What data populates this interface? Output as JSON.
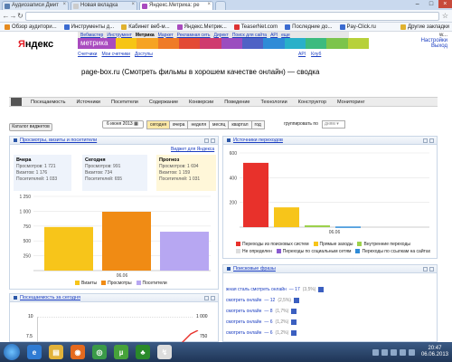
{
  "browser": {
    "tabs": [
      {
        "label": "Аудиозаписи Дмит",
        "favicon_color": "#5a7fb0",
        "active": false
      },
      {
        "label": "Новая вкладка",
        "favicon_color": "#cccccc",
        "active": false
      },
      {
        "label": "Яндекс.Метрика: ре",
        "favicon_color": "#a94bbf",
        "active": true
      }
    ],
    "bookmarks": [
      {
        "label": "Обзор аудитори...",
        "color": "#e58a1f"
      },
      {
        "label": "Инструменты д...",
        "color": "#3b6bd0"
      },
      {
        "label": "Кабинет веб-м...",
        "color": "#e0b22e"
      },
      {
        "label": "Яндекс.Метрик...",
        "color": "#a94bbf"
      },
      {
        "label": "TeaserNet.com",
        "color": "#d33"
      },
      {
        "label": "Последние до...",
        "color": "#3b6bd0"
      },
      {
        "label": "Pay-Click.ru",
        "color": "#3b6bd0"
      },
      {
        "label": "Другие закладки",
        "color": "#e0b22e"
      }
    ]
  },
  "yandex": {
    "logo": "Яндекс",
    "logo_first_letter": "Я",
    "logo_rest": "ндекс",
    "services": [
      "Вебмастер",
      "Инструмент",
      "Метрика",
      "Маркет",
      "Рекламная сеть",
      "Директ",
      "Поиск для сайта",
      "API",
      "еще"
    ],
    "metrika_label": "метрика",
    "sublinks": [
      "Счетчики",
      "Мои счетчики",
      "Доступы"
    ],
    "apilinks": [
      "API",
      "Клуб"
    ],
    "user": "w...",
    "user_links": [
      "Настройки",
      "Выход"
    ],
    "rainbow": [
      "#f6c515",
      "#f6a323",
      "#ef7b27",
      "#e34a35",
      "#cf3b6f",
      "#9b4dbf",
      "#4f62c5",
      "#2f8bd7",
      "#29b0c9",
      "#3cbb7f",
      "#7cc44b",
      "#b7d13a"
    ]
  },
  "page_title": "page-box.ru (Смотреть фильмы в хорошем качестве онлайн) — сводка",
  "nav": [
    "Посещаемость",
    "Источники",
    "Посетители",
    "Содержание",
    "Конверсии",
    "Поведение",
    "Технологии",
    "Конструктор",
    "Мониторинг"
  ],
  "toolbar": {
    "catalog": "Каталог виджетов",
    "date": "6 июня 2013",
    "periods": [
      "сегодня",
      "вчера",
      "неделя",
      "месяц",
      "квартал",
      "год"
    ],
    "selected_period": "сегодня",
    "group_label": "группировать по",
    "group_value": "дням"
  },
  "widget_traffic": {
    "title": "Просмотры, визиты и посетители",
    "link": "Виджет для Яндекса",
    "yesterday": {
      "title": "Вчера",
      "lines": [
        "Просмотров: 1 721",
        "Визитов: 1 176",
        "Посетителей: 1 033"
      ]
    },
    "today": {
      "title": "Сегодня",
      "lines": [
        "Просмотров: 991",
        "Визитов: 734",
        "Посетителей: 655"
      ]
    },
    "forecast": {
      "title": "Прогноз",
      "lines": [
        "Просмотров: 1 694",
        "Визитов: 1 159",
        "Посетителей: 1 031"
      ]
    },
    "y_ticks": [
      "1 250",
      "1 000",
      "750",
      "500",
      "250"
    ],
    "x_label": "06.06",
    "legend": [
      "Визиты",
      "Просмотры",
      "Посетители"
    ]
  },
  "chart_data": [
    {
      "type": "bar",
      "categories": [
        "06.06"
      ],
      "series": [
        {
          "name": "Визиты",
          "values": [
            734
          ],
          "color": "#f7c51a"
        },
        {
          "name": "Просмотры",
          "values": [
            991
          ],
          "color": "#f08b14"
        },
        {
          "name": "Посетители",
          "values": [
            655
          ],
          "color": "#b7a7f2"
        }
      ],
      "ylim": [
        0,
        1250
      ],
      "grid": true
    },
    {
      "type": "bar",
      "categories": [
        "06.06"
      ],
      "series": [
        {
          "name": "Переходы из поисковых систем",
          "values": [
            520
          ],
          "color": "#e8312b"
        },
        {
          "name": "Прямые заходы",
          "values": [
            160
          ],
          "color": "#f7c51a"
        },
        {
          "name": "Внутренние переходы",
          "values": [
            15
          ],
          "color": "#9dd14c"
        },
        {
          "name": "Переходы по ссылкам на сайтах",
          "values": [
            5
          ],
          "color": "#2f8bd7"
        }
      ],
      "ylim": [
        0,
        600
      ],
      "grid": true
    }
  ],
  "widget_sources": {
    "title": "Источники переходов",
    "y_ticks": [
      "600",
      "400",
      "200"
    ],
    "x_label": "06.06",
    "legend": [
      "Переходы из поисковых систем",
      "Прямые заходы",
      "Внутренние переходы",
      "Не определен",
      "Переходы по социальным сетям",
      "Переходы по ссылкам на сайтах"
    ],
    "legend_colors": [
      "#e8312b",
      "#f7c51a",
      "#9dd14c",
      "#dddddd",
      "#8a5cd0",
      "#2f8bd7"
    ]
  },
  "widget_phrases": {
    "title": "Поисковые фразы",
    "rows": [
      {
        "text": "жная сталь смотреть онлайн",
        "count": "— 17",
        "pct": "(3,5%)"
      },
      {
        "text": "смотреть онлайн",
        "count": "— 12",
        "pct": "(2,5%)"
      },
      {
        "text": "смотреть онлайн",
        "count": "— 8",
        "pct": "(1,7%)"
      },
      {
        "text": "смотреть онлайн",
        "count": "— 6",
        "pct": "(1,2%)"
      },
      {
        "text": "смотреть онлайн",
        "count": "— 6",
        "pct": "(1,2%)"
      }
    ]
  },
  "widget_today": {
    "title": "Посещаемость за сегодня",
    "left_ticks": [
      "10",
      "7.5"
    ],
    "right_ticks": [
      "1 000",
      "750"
    ]
  },
  "taskbar": {
    "time": "20:47",
    "date": "06.06.2013",
    "icons": [
      {
        "name": "ie-icon",
        "color": "#2f7bd3",
        "glyph": "e"
      },
      {
        "name": "explorer-icon",
        "color": "#e2b23a",
        "glyph": "▤"
      },
      {
        "name": "firefox-icon",
        "color": "#e56a1f",
        "glyph": "◉"
      },
      {
        "name": "chrome-icon",
        "color": "#3a9a48",
        "glyph": "◎"
      },
      {
        "name": "torrent-icon",
        "color": "#46a23a",
        "glyph": "µ"
      },
      {
        "name": "games-icon",
        "color": "#2a8a2a",
        "glyph": "♣"
      },
      {
        "name": "utorrent-icon",
        "color": "#dddddd",
        "glyph": "↯"
      }
    ]
  }
}
